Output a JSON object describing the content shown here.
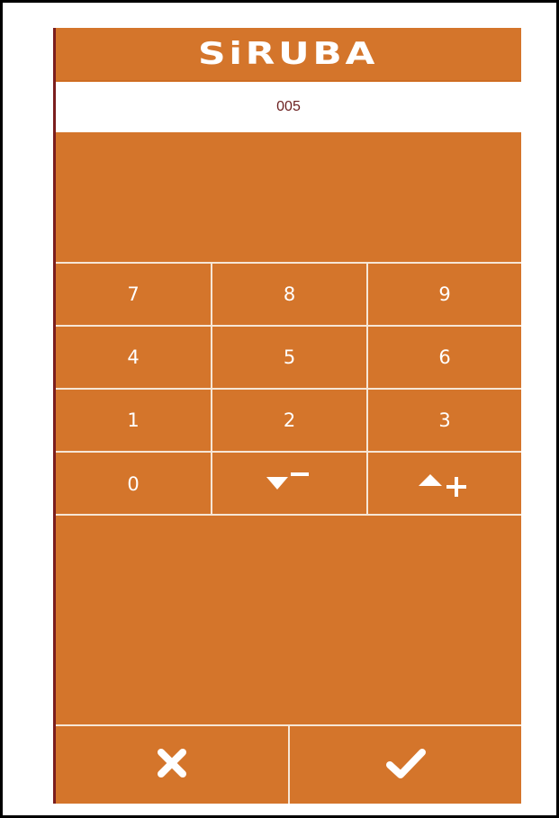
{
  "brand": {
    "logo_text": "SiRUBA"
  },
  "display": {
    "value": "005"
  },
  "keypad": {
    "rows": [
      [
        "7",
        "8",
        "9"
      ],
      [
        "4",
        "5",
        "6"
      ],
      [
        "1",
        "2",
        "3"
      ],
      [
        "0"
      ]
    ],
    "decrement_icon": "down-minus-icon",
    "increment_icon": "up-plus-icon"
  },
  "footer": {
    "cancel_icon": "close-icon",
    "confirm_icon": "checkmark-icon"
  },
  "colors": {
    "panel": "#d4752b",
    "divider": "#f6e6d6",
    "display_text": "#6b1f1f"
  }
}
